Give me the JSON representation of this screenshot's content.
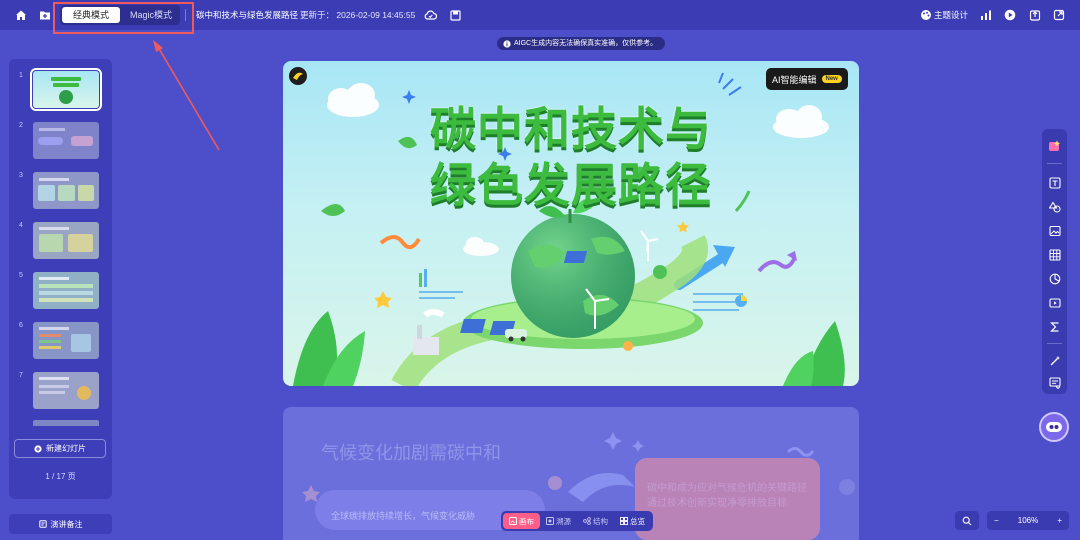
{
  "topbar": {
    "home_icon": "home-icon",
    "folder_icon": "folder-icon",
    "modes": [
      {
        "label": "经典模式",
        "active": true
      },
      {
        "label": "Magic模式",
        "active": false
      }
    ],
    "doc_title": "碳中和技术与绿色发展路径",
    "updated": "更新于： 2026-02-09 14:45:55",
    "theme_label": "主题设计",
    "highlight_color": "#f05a5a"
  },
  "notice": "AIGC生成内容无法确保真实准确，仅供参考。",
  "sidebar": {
    "slides": [
      "1",
      "2",
      "3",
      "4",
      "5",
      "6",
      "7"
    ],
    "new_slide": "新建幻灯片",
    "page_count": "1 / 17 页",
    "notes": "演讲备注"
  },
  "slide": {
    "title_line1": "碳中和技术与",
    "title_line2": "绿色发展路径",
    "ai_edit": "AI智能编辑",
    "new_badge": "New"
  },
  "slide2": {
    "title": "气候变化加剧需碳中和",
    "left_text": "全球碳排放持续增长，气候变化威胁",
    "right_text_line1": "碳中和成为应对气候危机的关键路径",
    "right_text_line2": "通过技术创新实现净零排放目标"
  },
  "bottom_tabs": [
    {
      "label": "画布",
      "active": true
    },
    {
      "label": "溯源",
      "active": false
    },
    {
      "label": "结构",
      "active": false
    },
    {
      "label": "总览",
      "active": false
    }
  ],
  "zoom": {
    "minus": "−",
    "value": "106%",
    "plus": "+"
  },
  "colors": {
    "background": "#4d4ec9",
    "topbar": "#3c3db4",
    "active_tab": "#ff5e88",
    "title_green": "#3dbb3f"
  }
}
